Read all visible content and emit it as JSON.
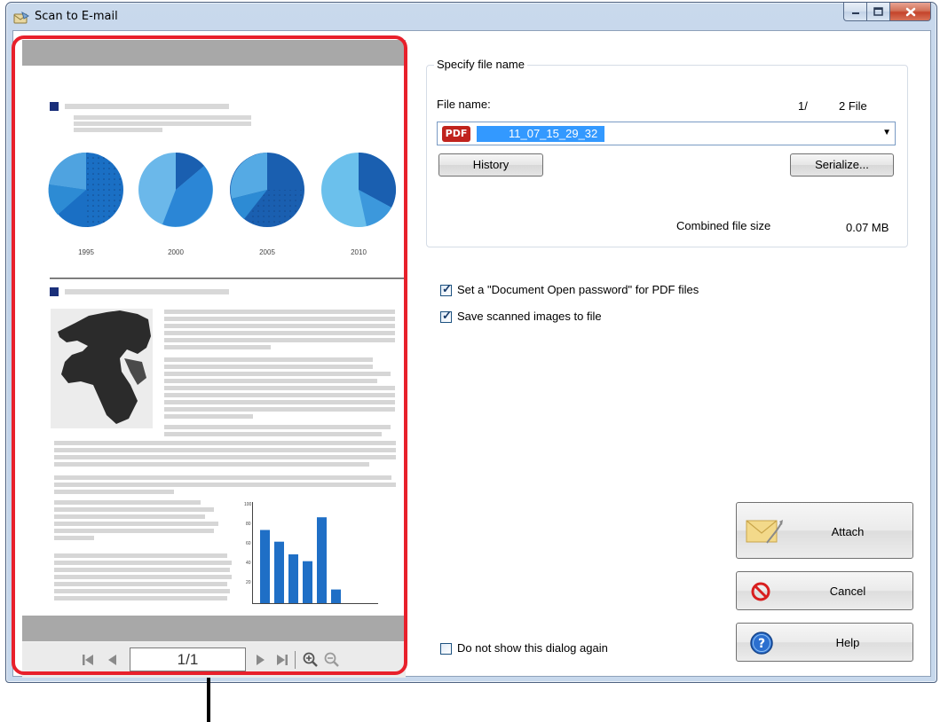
{
  "window": {
    "title": "Scan to E-mail"
  },
  "preview": {
    "year_labels": [
      "1995",
      "2000",
      "2005",
      "2010"
    ],
    "bar_chart": {
      "yticks": [
        "100",
        "80",
        "60",
        "40",
        "20"
      ],
      "values": [
        75,
        63,
        50,
        43,
        88,
        14
      ]
    },
    "page_indicator": "1/1"
  },
  "file_group": {
    "legend": "Specify file name",
    "file_name_label": "File name:",
    "file_counter": "1/",
    "file_count_value": "2 File",
    "file_type_badge": "PDF",
    "file_name_value": "11_07_15_29_32",
    "history_button": "History",
    "serialize_button": "Serialize...",
    "combined_size_label": "Combined file size",
    "combined_size_value": "0.07 MB"
  },
  "options": {
    "pdf_password": {
      "label": "Set a \"Document Open password\" for PDF files",
      "checked": true
    },
    "save_images": {
      "label": "Save scanned images to file",
      "checked": true
    },
    "dont_show": {
      "label": "Do not show this dialog again",
      "checked": false
    }
  },
  "actions": {
    "attach": "Attach",
    "cancel": "Cancel",
    "help": "Help"
  }
}
